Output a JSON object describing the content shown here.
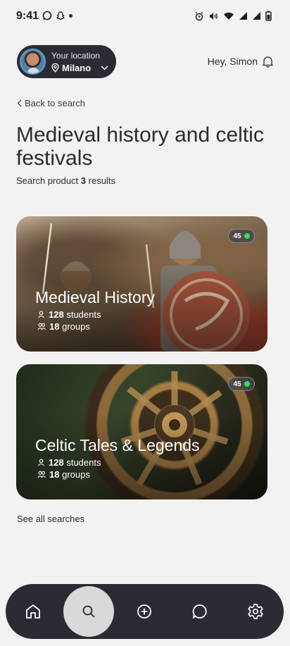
{
  "status_bar": {
    "time": "9:41",
    "left_icons": [
      "whatsapp-icon",
      "snapchat-icon",
      "dot-icon"
    ],
    "right_icons": [
      "alarm-icon",
      "vibrate-icon",
      "wifi-icon",
      "signal-icon",
      "signal-icon",
      "battery-icon"
    ]
  },
  "header": {
    "location_label": "Your location",
    "location_city": "Milano",
    "greeting": "Hey, Simon"
  },
  "nav": {
    "back_label": "Back to search"
  },
  "search": {
    "title": "Medieval history and celtic festivals",
    "results_prefix": "Search product",
    "results_count": "3",
    "results_suffix": "results"
  },
  "cards": [
    {
      "title": "Medieval History",
      "badge": "45",
      "students_count": "128",
      "students_label": "students",
      "groups_count": "18",
      "groups_label": "groups"
    },
    {
      "title": "Celtic Tales & Legends",
      "badge": "45",
      "students_count": "128",
      "students_label": "students",
      "groups_count": "18",
      "groups_label": "groups"
    }
  ],
  "footer": {
    "see_all": "See all searches"
  },
  "bottom_nav": {
    "items": [
      "home-icon",
      "search-icon",
      "add-icon",
      "chat-icon",
      "settings-icon"
    ],
    "active": "search-icon"
  },
  "colors": {
    "background": "#f2f2f2",
    "dark": "#2b2b33",
    "badge_dot": "#2ee05a",
    "active_nav": "#d9d9d9"
  }
}
